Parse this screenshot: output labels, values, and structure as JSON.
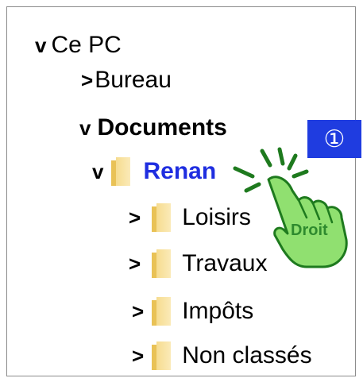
{
  "tree": {
    "root": {
      "chevron": "v",
      "label": "Ce PC"
    },
    "bureau": {
      "chevron": ">",
      "label": "Bureau"
    },
    "documents": {
      "chevron": "v",
      "label": "Documents"
    },
    "renan": {
      "chevron": "v",
      "label": "Renan"
    },
    "children": [
      {
        "chevron": ">",
        "label": "Loisirs"
      },
      {
        "chevron": ">",
        "label": "Travaux"
      },
      {
        "chevron": ">",
        "label": "Impôts"
      },
      {
        "chevron": ">",
        "label": "Non classés"
      }
    ]
  },
  "annotation": {
    "step_badge": "①",
    "hand_label": "Droit"
  },
  "colors": {
    "selected_text": "#1f2ee0",
    "badge_bg": "#1f3ce0",
    "hand_fill": "#90e070",
    "hand_stroke": "#1e7a1e",
    "folder": "#f3d27a"
  },
  "icons": {
    "folder": "folder-icon",
    "hand": "pointing-hand-icon"
  }
}
